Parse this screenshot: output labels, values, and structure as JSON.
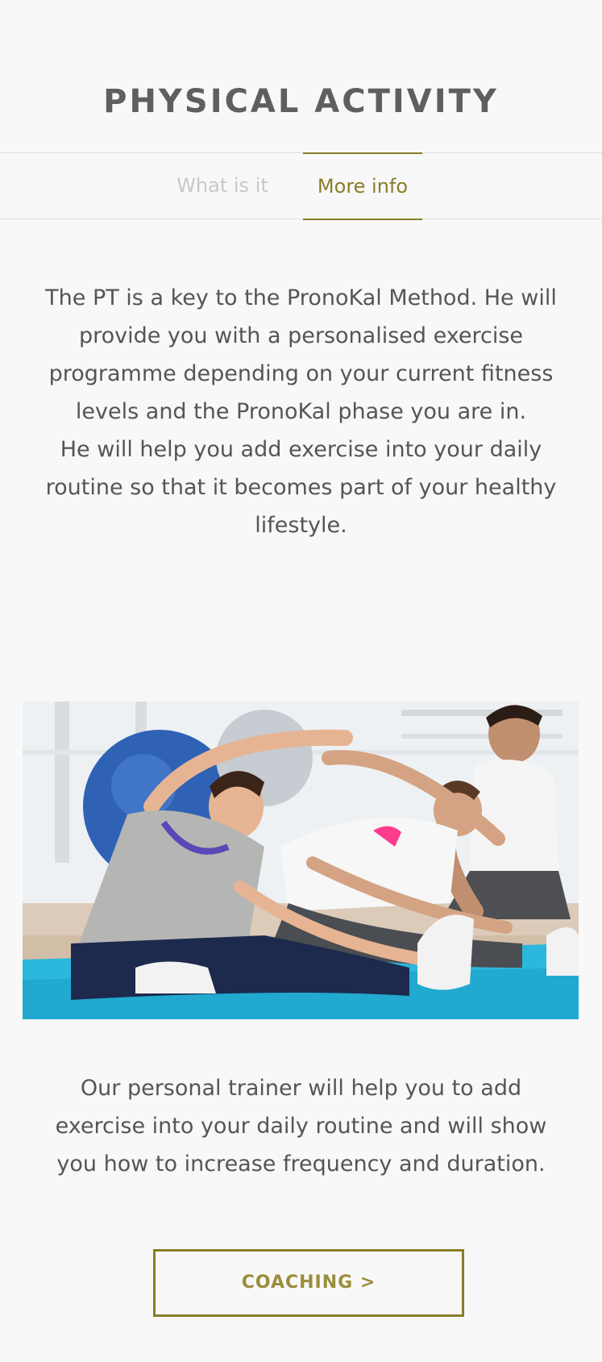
{
  "header": {
    "title": "PHYSICAL ACTIVITY"
  },
  "tabs": [
    {
      "label": "What is it",
      "active": false
    },
    {
      "label": "More info",
      "active": true
    }
  ],
  "content": {
    "intro_paragraph_1": "The PT is a key to the PronoKal Method. He will provide you with a personalised exercise programme depending on your current fitness levels and the PronoKal phase you are in.",
    "intro_paragraph_2": "He will help you add exercise into your daily routine so that it becomes part of your healthy lifestyle.",
    "outro_paragraph": "Our personal trainer will help you to add exercise into your daily routine and will show you how to increase frequency and duration."
  },
  "cta": {
    "label": "COACHING >"
  },
  "colors": {
    "background": "#f8f8f8",
    "accent": "#8a7d28",
    "text": "#555555",
    "inactive_tab": "#c8c8c8",
    "divider": "#dddddd"
  }
}
